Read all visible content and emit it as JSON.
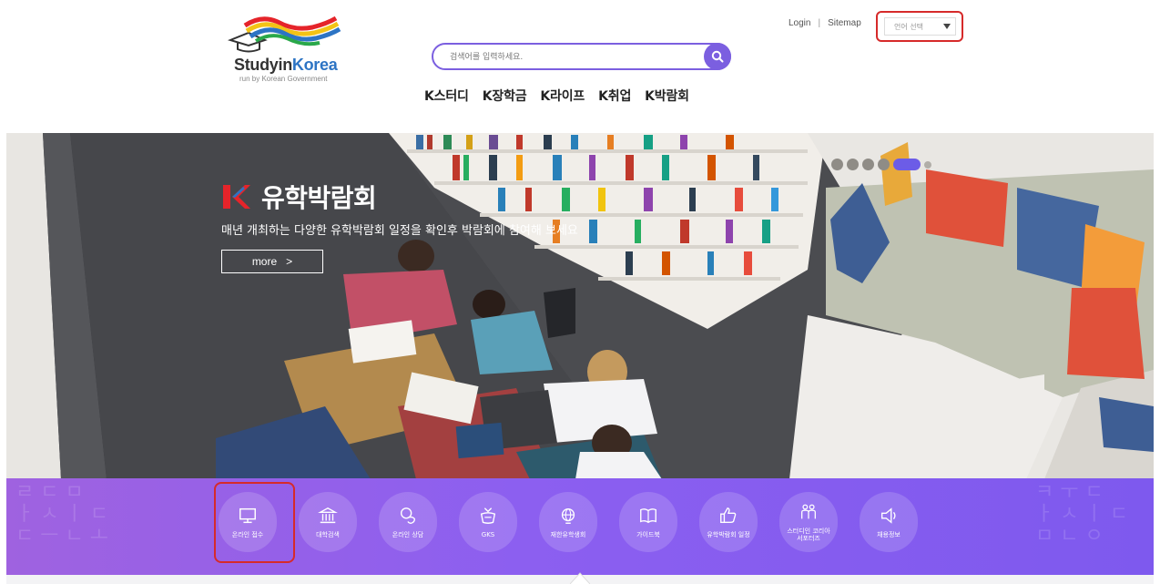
{
  "header": {
    "logo_text_1": "Studyin",
    "logo_text_2": "Korea",
    "logo_sub": "run by Korean Government",
    "search_placeholder": "검색어를 입력하세요.",
    "login": "Login",
    "separator": "|",
    "sitemap": "Sitemap",
    "language_select": "언어 선택"
  },
  "nav": [
    {
      "label": "K스터디"
    },
    {
      "label": "K장학금"
    },
    {
      "label": "K라이프"
    },
    {
      "label": "K취업"
    },
    {
      "label": "K박람회"
    }
  ],
  "hero": {
    "title": "유학박람회",
    "subtitle": "매년 개최하는 다양한 유학박람회 일정을 확인후 박람회에 참여해 보세요",
    "more_label": "more",
    "more_arrow": ">",
    "slide_count": 6,
    "active_slide": 5
  },
  "quick_menu": [
    {
      "label": "온라인 접수",
      "icon": "monitor-icon"
    },
    {
      "label": "대학검색",
      "icon": "university-icon"
    },
    {
      "label": "온라인 상담",
      "icon": "chat-bubbles-icon"
    },
    {
      "label": "GKS",
      "icon": "scholarship-icon"
    },
    {
      "label": "재한유학생회",
      "icon": "globe-icon"
    },
    {
      "label": "가이드북",
      "icon": "guidebook-icon"
    },
    {
      "label": "유학박람회 일정",
      "icon": "thumbs-up-icon"
    },
    {
      "label": "스터디인 코리아\n서포터즈",
      "icon": "supporters-icon"
    },
    {
      "label": "채용정보",
      "icon": "megaphone-icon"
    }
  ],
  "colors": {
    "accent": "#7b5fe0",
    "highlight": "#d62a2a",
    "quickbar": "#8c5ff0"
  }
}
